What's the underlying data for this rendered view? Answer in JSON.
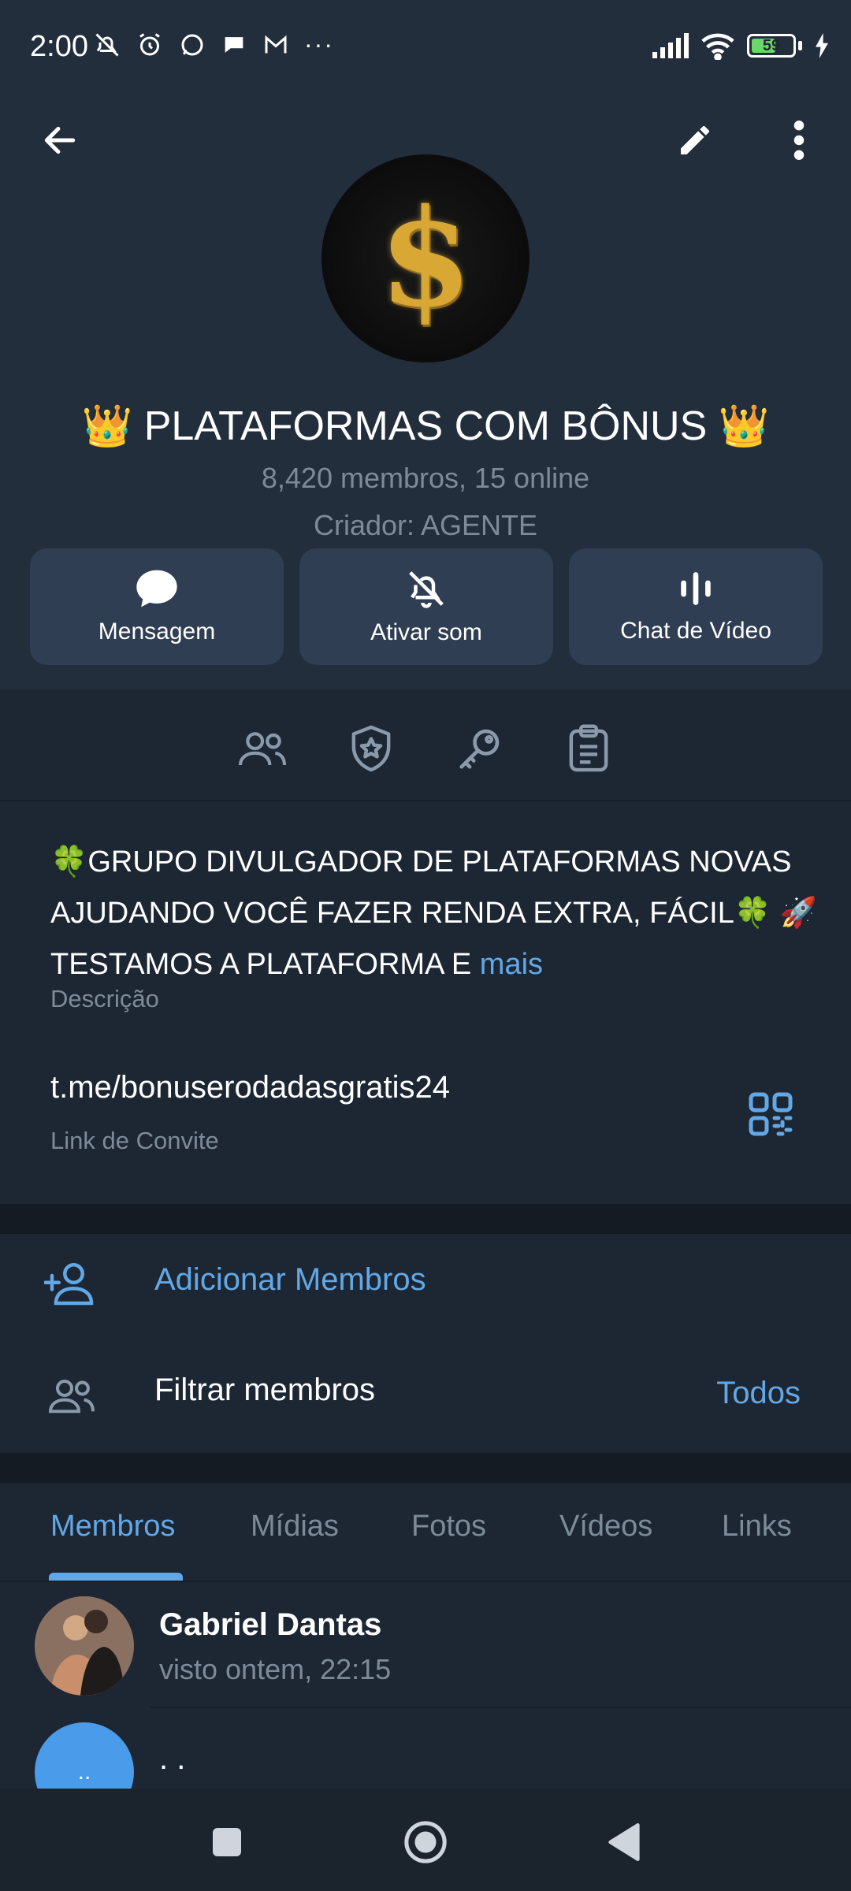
{
  "status_bar": {
    "time": "2:00",
    "battery_level": "59",
    "battery_fraction": 0.59
  },
  "header": {
    "back_icon": "arrow-left-icon",
    "edit_icon": "pencil-icon",
    "more_icon": "more-vertical-icon",
    "avatar_symbol": "$",
    "title": "👑 PLATAFORMAS COM BÔNUS 👑",
    "members_info": "8,420 membros, 15 online",
    "creator": "Criador: AGENTE"
  },
  "actions": [
    {
      "label": "Mensagem",
      "icon": "chat-bubble-icon"
    },
    {
      "label": "Ativar som",
      "icon": "bell-off-icon"
    },
    {
      "label": "Chat de Vídeo",
      "icon": "voice-chat-icon"
    }
  ],
  "icon_tabs": [
    "members-icon",
    "admin-shield-icon",
    "key-icon",
    "clipboard-icon"
  ],
  "description": {
    "text": "🍀GRUPO DIVULGADOR DE PLATAFORMAS NOVAS AJUDANDO VOCÊ FAZER RENDA EXTRA, FÁCIL🍀  🚀TESTAMOS A PLATAFORMA E",
    "more": "mais",
    "caption": "Descrição"
  },
  "invite_link": {
    "url": "t.me/bonuserodadasgratis24",
    "caption": "Link de Convite"
  },
  "member_actions": {
    "add_label": "Adicionar Membros",
    "filter_label": "Filtrar membros",
    "filter_value": "Todos"
  },
  "tabs": [
    {
      "label": "Membros",
      "active": true
    },
    {
      "label": "Mídias",
      "active": false
    },
    {
      "label": "Fotos",
      "active": false
    },
    {
      "label": "Vídeos",
      "active": false
    },
    {
      "label": "Links",
      "active": false
    }
  ],
  "members": [
    {
      "name": "Gabriel Dantas",
      "status": "visto ontem, 22:15"
    },
    {
      "name": ". .",
      "avatar_text": ".."
    }
  ],
  "colors": {
    "background": "#1d2733",
    "header": "#232e3c",
    "accent": "#63a8e6",
    "muted_text": "#7d8b99",
    "button": "#2f3e52"
  }
}
